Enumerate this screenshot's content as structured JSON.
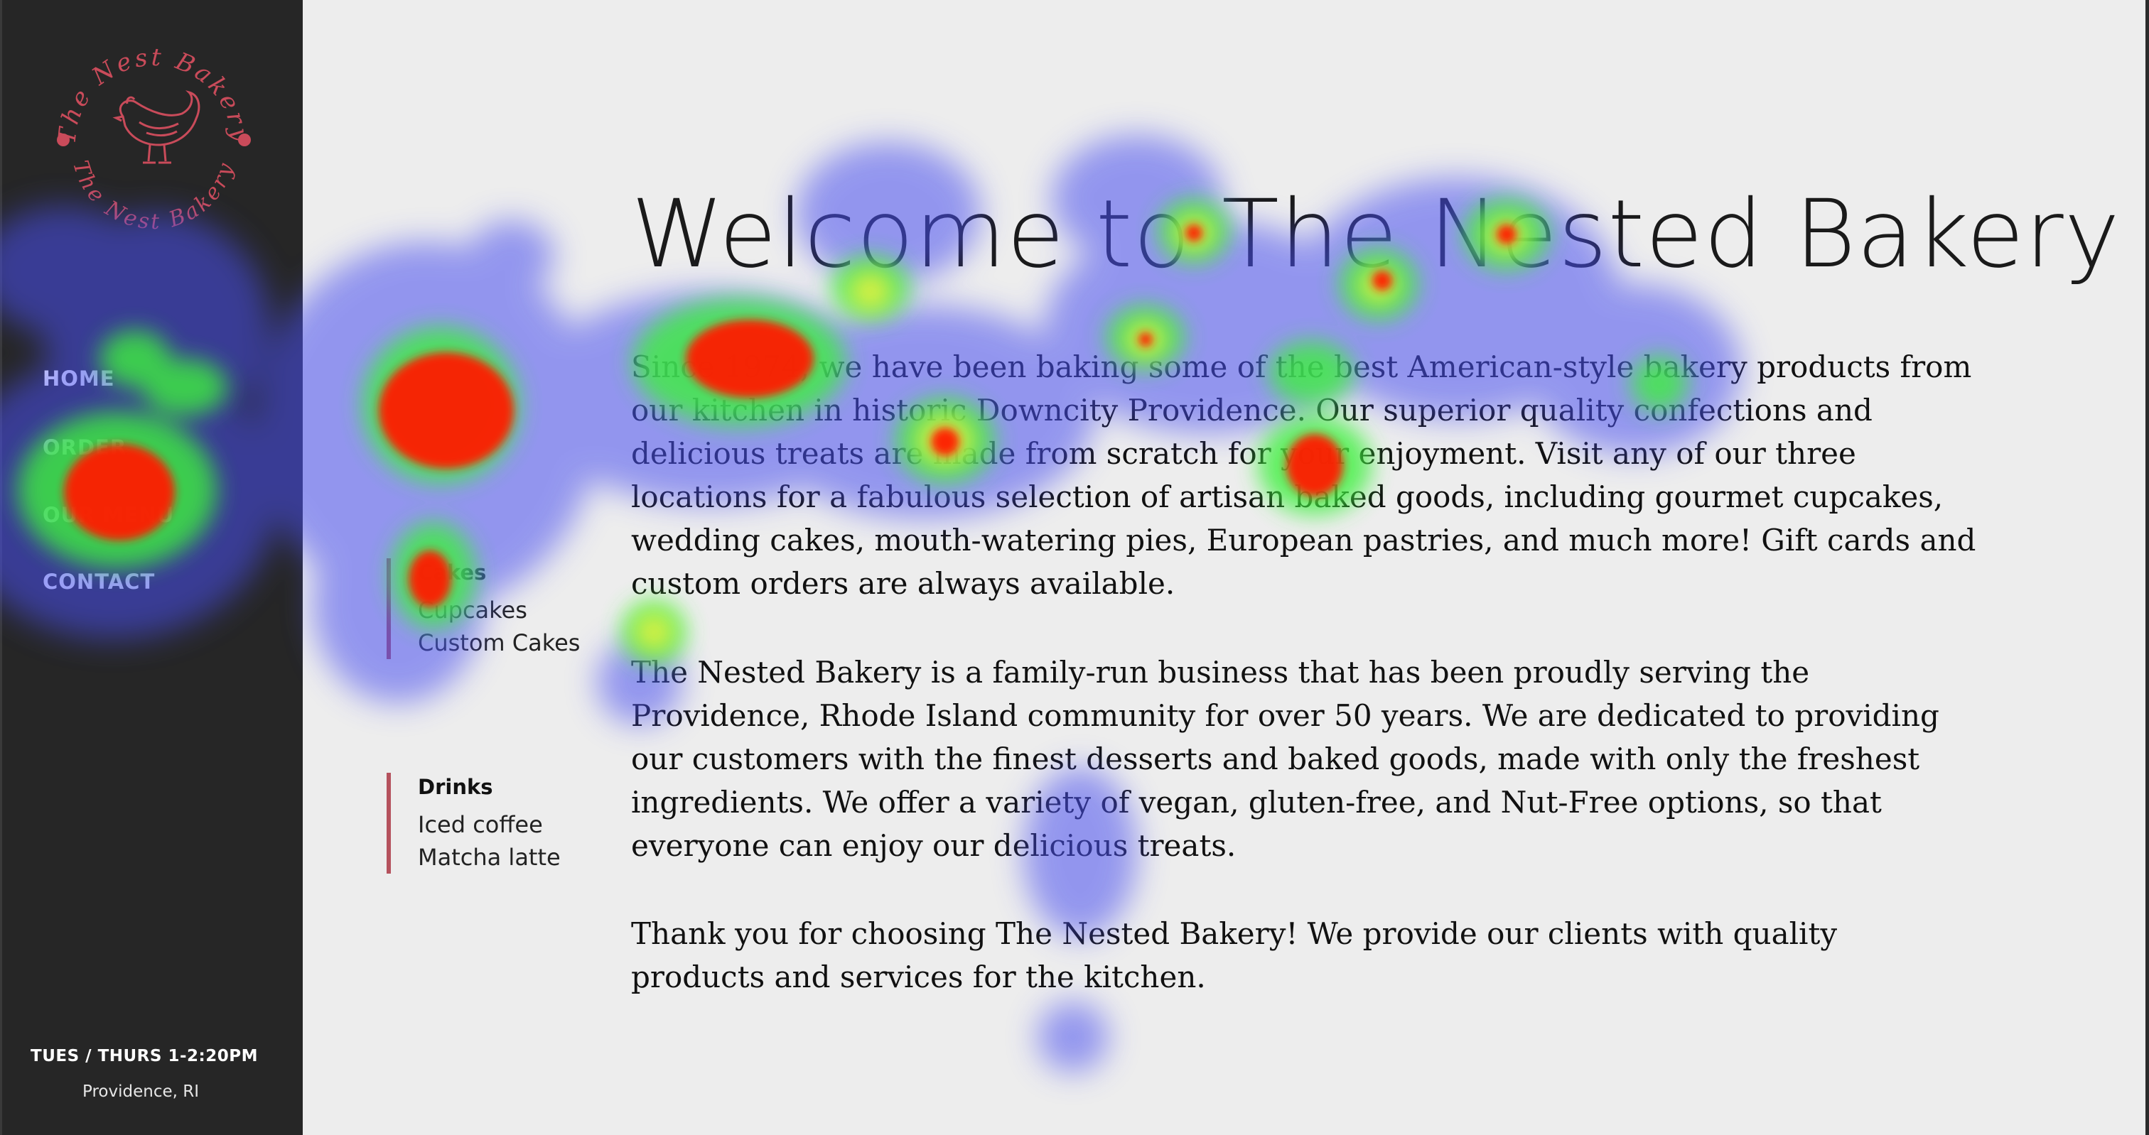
{
  "brand": {
    "name": "The Nest Bakery",
    "logo_top_text": "The Nest Bakery",
    "logo_bottom_text": "The Nest Bakery",
    "accent_color": "#c94b5a"
  },
  "nav": {
    "items": [
      {
        "label": "HOME"
      },
      {
        "label": "ORDER"
      },
      {
        "label": "OUR MENU"
      },
      {
        "label": "CONTACT"
      }
    ]
  },
  "footer": {
    "hours": "TUES / THURS 1-2:20PM",
    "location": "Providence, RI"
  },
  "menu_groups": [
    {
      "title": "Cakes",
      "items": [
        "Cupcakes",
        "Custom Cakes"
      ]
    },
    {
      "title": "Drinks",
      "items": [
        "Iced coffee",
        "Matcha latte"
      ]
    }
  ],
  "main": {
    "title": "Welcome to The Nested Bakery",
    "paragraphs": [
      [
        "Since 1974, we have been baking some of the best American-style bakery products from",
        "our kitchen in historic Downcity Providence. Our superior quality confections and",
        "delicious treats are made from scratch for your enjoyment. Visit any of our three",
        "locations for a fabulous selection of artisan baked goods, including gourmet cupcakes,",
        "wedding cakes, mouth-watering pies, European pastries, and much more! Gift cards and",
        "custom orders are always available."
      ],
      [
        "The Nested Bakery is a family-run business that has been proudly serving the",
        "Providence, Rhode Island community for over 50 years. We are dedicated to providing",
        "our customers with the finest desserts and baked goods, made with only the freshest",
        "ingredients. We offer a variety of vegan, gluten-free, and Nut-Free options, so that",
        "everyone can enjoy our delicious treats."
      ],
      [
        "Thank you for choosing The Nested Bakery! We provide our clients with quality",
        "products and services for the kitchen."
      ]
    ]
  },
  "heatmap_colors": {
    "cold": "#4a4ff0",
    "mid": "#3cf03c",
    "warm": "#f0f03c",
    "hot": "#ff1e00"
  }
}
